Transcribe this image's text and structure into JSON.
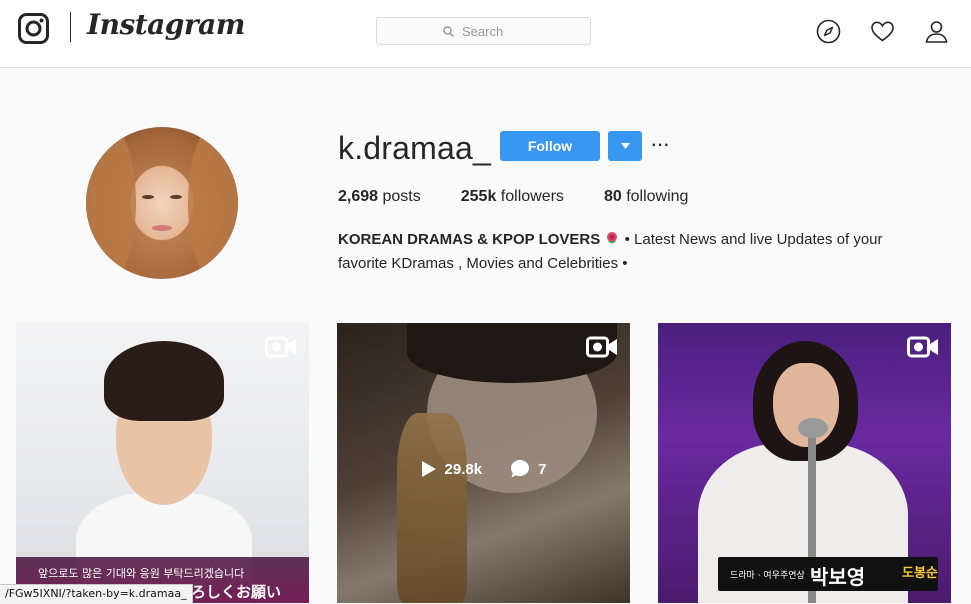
{
  "header": {
    "wordmark": "Instagram",
    "search_placeholder": "Search"
  },
  "profile": {
    "username": "k.dramaa_",
    "follow_label": "Follow",
    "more_label": "···",
    "stats": {
      "posts_count": "2,698",
      "posts_label": "posts",
      "followers_count": "255k",
      "followers_label": "followers",
      "following_count": "80",
      "following_label": "following"
    },
    "bio_name": "KOREAN DRAMAS & KPOP LOVERS",
    "bio_line1_rest": " • Latest News and live Updates of your",
    "bio_line2": "favorite KDramas , Movies and Celebrities •"
  },
  "posts": [
    {
      "type": "video",
      "caption": "앞으로도 많은 기대와 응원 부탁드리겠습니다",
      "caption_overlay": "よろしくお願い"
    },
    {
      "type": "video",
      "plays": "29.8k",
      "comments": "7"
    },
    {
      "type": "video",
      "banner_sub": "드라마 · 여우주연상",
      "banner_name": "박보영",
      "banner_badge": "도봉순"
    }
  ],
  "status_bar": {
    "url": "/FGw5IXNI/?taken-by=k.dramaa_"
  },
  "colors": {
    "accent": "#3897f0",
    "text": "#262626",
    "border": "#dbdbdb",
    "background": "#fafafa"
  }
}
